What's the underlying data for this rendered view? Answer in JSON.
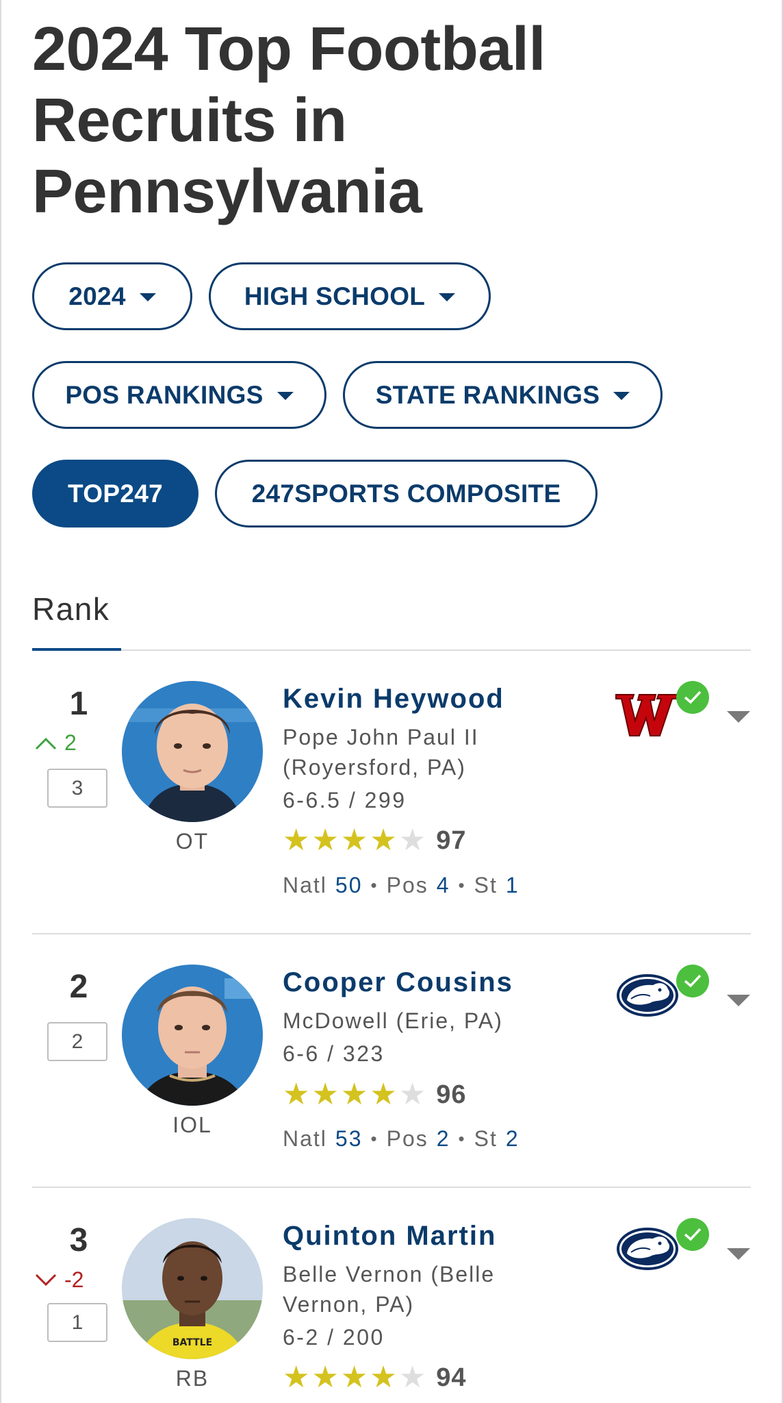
{
  "page": {
    "title": "2024 Top Football Recruits in Pennsylvania"
  },
  "filters": {
    "year": "2024",
    "level": "HIGH SCHOOL",
    "pos_rankings": "POS RANKINGS",
    "state_rankings": "STATE RANKINGS",
    "top247": "TOP247",
    "composite": "247SPORTS COMPOSITE"
  },
  "table": {
    "rank_header": "Rank"
  },
  "players": [
    {
      "rank": "1",
      "movement": "2",
      "movement_dir": "up",
      "prev_rank": "3",
      "position": "OT",
      "name": "Kevin Heywood",
      "school_line1": "Pope John Paul II",
      "school_line2": "(Royersford, PA)",
      "measurements": "6-6.5 / 299",
      "stars": 4,
      "rating": "97",
      "natl_label": "Natl",
      "natl": "50",
      "pos_label": "Pos",
      "pos_rank": "4",
      "st_label": "St",
      "st": "1",
      "commit_logo": "wisconsin-logo",
      "committed_icon": "check-circle-icon"
    },
    {
      "rank": "2",
      "prev_rank": "2",
      "position": "IOL",
      "name": "Cooper Cousins",
      "school_line1": "McDowell (Erie, PA)",
      "measurements": "6-6 / 323",
      "stars": 4,
      "rating": "96",
      "natl_label": "Natl",
      "natl": "53",
      "pos_label": "Pos",
      "pos_rank": "2",
      "st_label": "St",
      "st": "2",
      "commit_logo": "penn-state-logo",
      "committed_icon": "check-circle-icon"
    },
    {
      "rank": "3",
      "movement": "-2",
      "movement_dir": "down",
      "prev_rank": "1",
      "position": "RB",
      "name": "Quinton Martin",
      "school_line1": "Belle Vernon (Belle",
      "school_line2": "Vernon, PA)",
      "measurements": "6-2 / 200",
      "stars": 4,
      "rating": "94",
      "commit_logo": "penn-state-logo",
      "committed_icon": "check-circle-icon"
    }
  ],
  "colors": {
    "brand_navy": "#0b3b6b",
    "active_blue": "#0b4a86",
    "star_gold": "#d4c21f",
    "check_green": "#4cbf3e",
    "up_green": "#3fa33f",
    "down_red": "#b22222"
  }
}
